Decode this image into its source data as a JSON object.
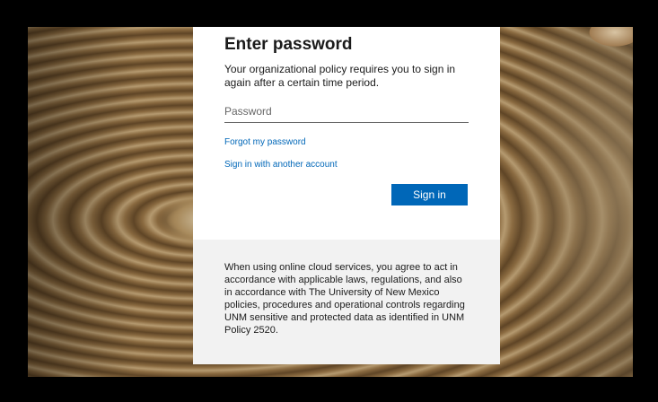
{
  "card": {
    "title": "Enter password",
    "description": "Your organizational policy requires you to sign in again after a certain time period.",
    "password_placeholder": "Password",
    "password_value": "",
    "forgot_link": "Forgot my password",
    "another_account_link": "Sign in with another account",
    "signin_button": "Sign in"
  },
  "footer": {
    "notice": "When using online cloud services, you agree to act in accordance with applicable laws, regulations, and also in accordance with The University of New Mexico policies, procedures and operational controls regarding UNM sensitive and protected data as identified in UNM Policy 2520."
  },
  "colors": {
    "accent": "#0067b8",
    "footer_bg": "#f2f2f2",
    "text": "#1b1b1b"
  }
}
